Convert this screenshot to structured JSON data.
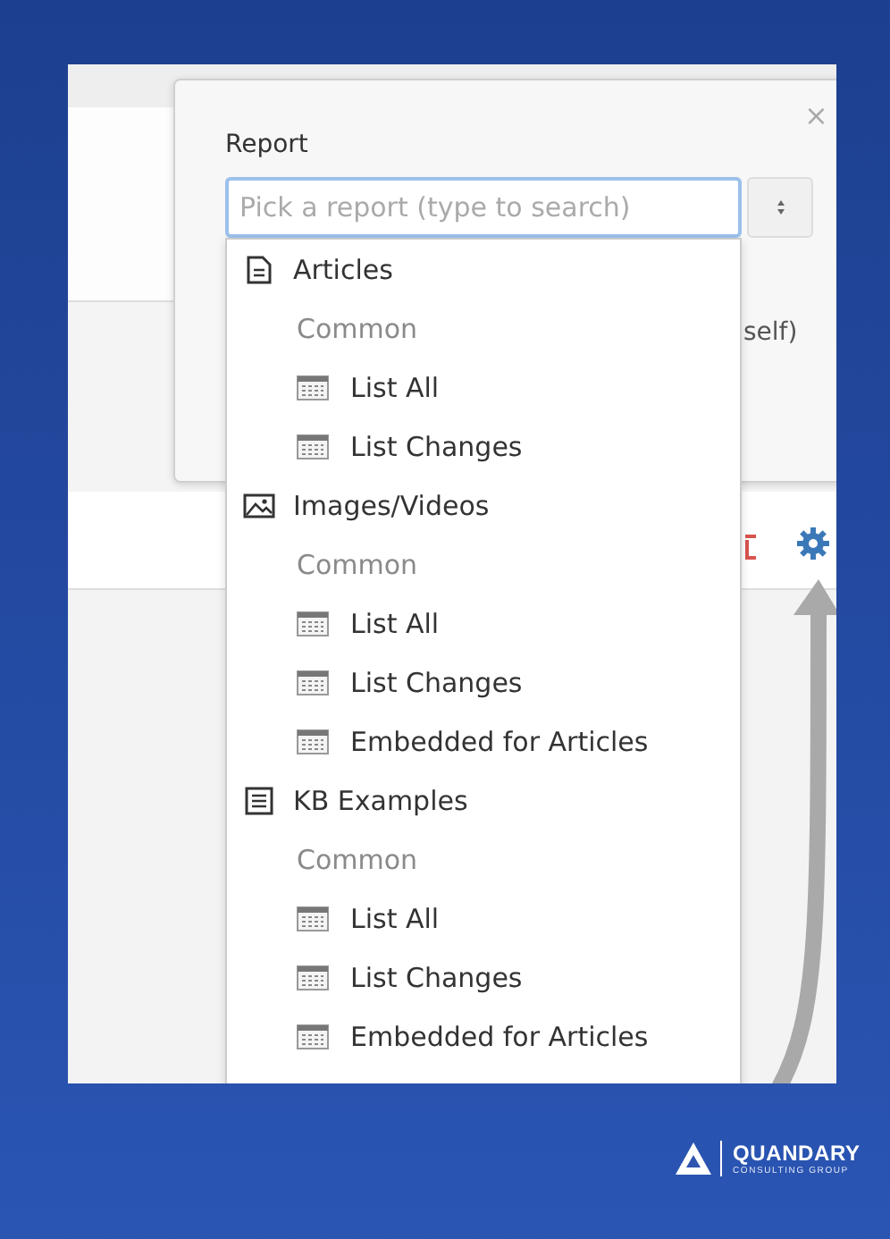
{
  "report_panel": {
    "close": "×",
    "label": "Report",
    "search": {
      "placeholder": "Pick a report (type to search)"
    },
    "partial_text": "self)"
  },
  "dropdown": {
    "groups": [
      {
        "name": "Articles",
        "kind": "document",
        "section": "Common",
        "items": [
          "List All",
          "List Changes"
        ]
      },
      {
        "name": "Images/Videos",
        "kind": "image",
        "section": "Common",
        "items": [
          "List All",
          "List Changes",
          "Embedded for Articles"
        ]
      },
      {
        "name": "KB Examples",
        "kind": "list",
        "section": "Common",
        "items": [
          "List All",
          "List Changes",
          "Embedded for Articles"
        ]
      }
    ]
  },
  "logo": {
    "name": "QUANDARY",
    "tagline": "CONSULTING GROUP"
  }
}
